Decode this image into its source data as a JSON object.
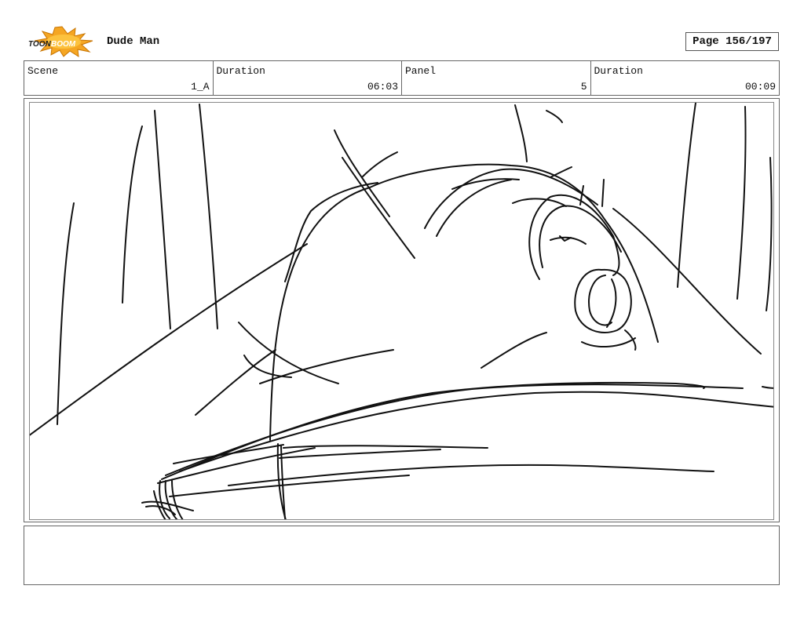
{
  "header": {
    "logo_text": "TOONBOOM",
    "title": "Dude Man",
    "page": "Page 156/197"
  },
  "info": {
    "scene_label": "Scene",
    "scene_value": "1_A",
    "duration_label": "Duration",
    "duration_value": "06:03",
    "panel_label": "Panel",
    "panel_value": "5",
    "panel_duration_label": "Duration",
    "panel_duration_value": "00:09"
  },
  "notes": {
    "text": ""
  },
  "colors": {
    "logo_burst": "#f5a623",
    "logo_text": "#1a1a1a",
    "sketch_ink": "#111111"
  }
}
